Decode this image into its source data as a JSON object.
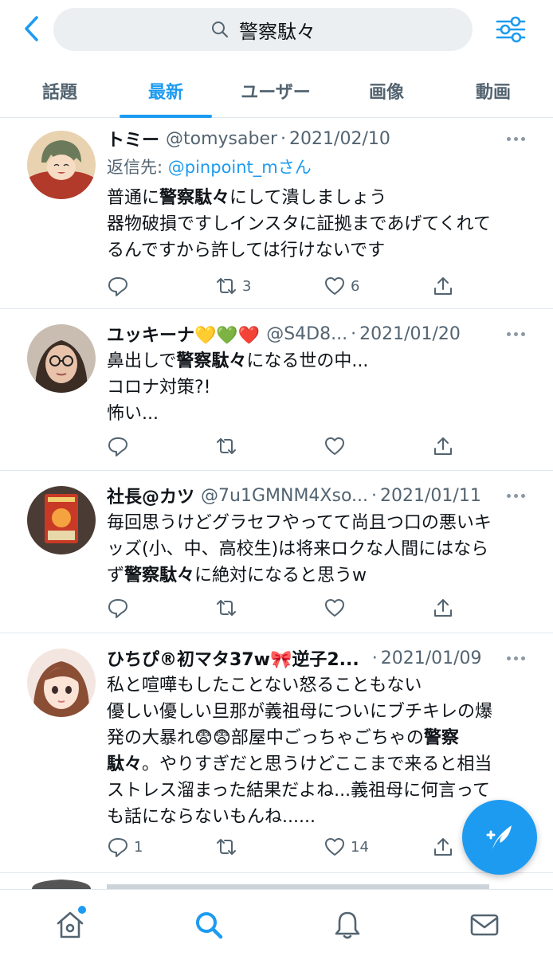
{
  "header": {
    "search_query": "警察駄々",
    "accent_color": "#1d9bf0"
  },
  "tabs": [
    {
      "label": "話題"
    },
    {
      "label": "最新"
    },
    {
      "label": "ユーザー"
    },
    {
      "label": "画像"
    },
    {
      "label": "動画"
    }
  ],
  "tweets": [
    {
      "name": "トミー",
      "handle": "@tomysaber",
      "sep": "·",
      "date": "2021/02/10",
      "reply_prefix": "返信先: ",
      "reply_handle": "@pinpoint_mさん",
      "lines": [
        {
          "pre": "普通に",
          "bold": "警察駄々",
          "post": "にして潰しましょう"
        },
        {
          "pre": "器物破損ですしインスタに証拠まであげてくれて",
          "bold": "",
          "post": ""
        },
        {
          "pre": "るんですから許しては行けないです",
          "bold": "",
          "post": ""
        }
      ],
      "replies": "",
      "retweets": "3",
      "likes": "6"
    },
    {
      "name": "ユッキーナ💛💚❤️",
      "handle": "@S4D8...",
      "sep": "·",
      "date": "2021/01/20",
      "lines": [
        {
          "pre": "鼻出しで",
          "bold": "警察駄々",
          "post": "になる世の中..."
        },
        {
          "pre": "コロナ対策?!",
          "bold": "",
          "post": ""
        },
        {
          "pre": "怖い...",
          "bold": "",
          "post": ""
        }
      ],
      "replies": "",
      "retweets": "",
      "likes": ""
    },
    {
      "name": "社長@カツ",
      "handle": "@7u1GMNM4Xso...",
      "sep": "·",
      "date": "2021/01/11",
      "lines": [
        {
          "pre": "毎回思うけどグラセフやってて尚且つ口の悪いキ",
          "bold": "",
          "post": ""
        },
        {
          "pre": "ッズ(小、中、高校生)は将来ロクな人間にはなら",
          "bold": "",
          "post": ""
        },
        {
          "pre": "ず",
          "bold": "警察駄々",
          "post": "に絶対になると思うw"
        }
      ],
      "replies": "",
      "retweets": "",
      "likes": ""
    },
    {
      "name": "ひちぴ®初マタ37w🎀逆子2...",
      "handle": "",
      "sep": "·",
      "date": "2021/01/09",
      "lines": [
        {
          "pre": "私と喧嘩もしたことない怒ることもない",
          "bold": "",
          "post": ""
        },
        {
          "pre": "優しい優しい旦那が義祖母についにブチキレの爆",
          "bold": "",
          "post": ""
        },
        {
          "pre": "発の大暴れ😨😨部屋中ごっちゃごちゃの",
          "bold": "警察",
          "post": ""
        },
        {
          "pre": "",
          "bold": "駄々",
          "post": "。やりすぎだと思うけどここまで来ると相当"
        },
        {
          "pre": "ストレス溜まった結果だよね...義祖母に何言って",
          "bold": "",
          "post": ""
        },
        {
          "pre": "も話にならないもんね......",
          "bold": "",
          "post": ""
        }
      ],
      "replies": "1",
      "retweets": "",
      "likes": "14"
    }
  ],
  "icons": {
    "back": "chevron-left-icon",
    "search": "search-icon",
    "filter": "sliders-icon",
    "reply": "reply-icon",
    "retweet": "retweet-icon",
    "like": "heart-icon",
    "share": "share-icon",
    "compose": "compose-icon",
    "home": "home-icon",
    "explore": "search-icon",
    "notifications": "bell-icon",
    "messages": "mail-icon"
  }
}
